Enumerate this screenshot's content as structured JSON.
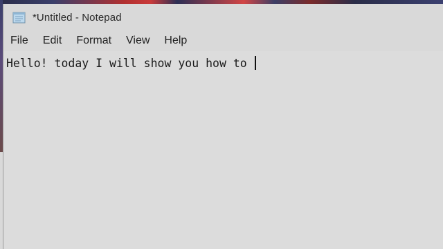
{
  "window": {
    "title": "*Untitled - Notepad",
    "icon": "notepad-icon"
  },
  "menu": {
    "items": [
      {
        "label": "File"
      },
      {
        "label": "Edit"
      },
      {
        "label": "Format"
      },
      {
        "label": "View"
      },
      {
        "label": "Help"
      }
    ]
  },
  "editor": {
    "text": "Hello! today I will show you how to "
  }
}
